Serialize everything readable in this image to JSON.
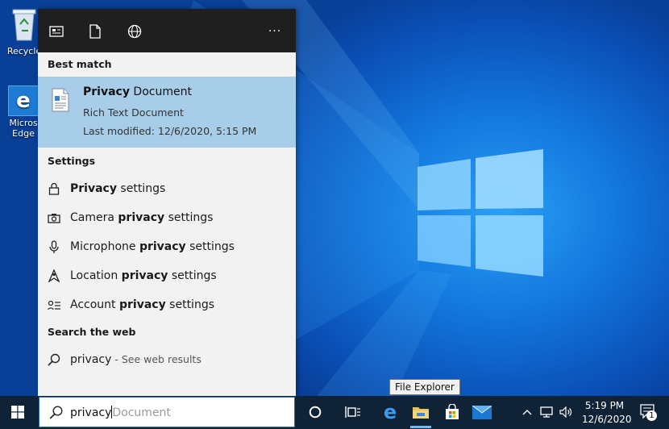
{
  "desktop": {
    "icons": [
      {
        "label": "Recycle",
        "icon": "recycle-bin-icon"
      },
      {
        "label": "Micros Edge",
        "label_line1": "Micros",
        "label_line2": "Edge",
        "icon": "edge-icon"
      }
    ]
  },
  "start_menu": {
    "top_icons": [
      "documents-filter-icon",
      "file-filter-icon",
      "web-filter-icon",
      "more-icon"
    ],
    "more_label": "···",
    "best_match": {
      "header": "Best match",
      "title_bold": "Privacy",
      "title_rest": " Document",
      "type": "Rich Text Document",
      "modified": "Last modified: 12/6/2020, 5:15 PM"
    },
    "settings": {
      "header": "Settings",
      "items": [
        {
          "pre": "",
          "bold": "Privacy",
          "post": " settings",
          "icon": "lock-icon"
        },
        {
          "pre": "Camera ",
          "bold": "privacy",
          "post": " settings",
          "icon": "camera-icon"
        },
        {
          "pre": "Microphone ",
          "bold": "privacy",
          "post": " settings",
          "icon": "microphone-icon"
        },
        {
          "pre": "Location ",
          "bold": "privacy",
          "post": " settings",
          "icon": "location-icon"
        },
        {
          "pre": "Account ",
          "bold": "privacy",
          "post": " settings",
          "icon": "account-icon"
        }
      ]
    },
    "web": {
      "header": "Search the web",
      "query": "privacy",
      "suffix": " - See web results"
    }
  },
  "taskbar": {
    "search_value": "privacy",
    "search_placeholder": "Document",
    "tooltip": "File Explorer",
    "time": "5:19 PM",
    "date": "12/6/2020",
    "notification_count": "1",
    "accent": "#0078d7"
  }
}
